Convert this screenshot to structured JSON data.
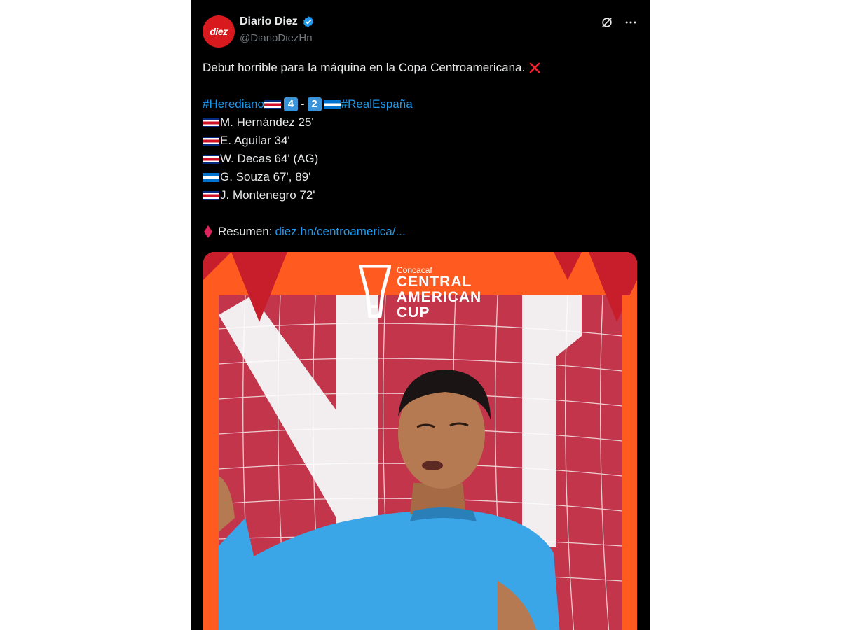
{
  "account": {
    "avatar_text": "diez",
    "display_name": "Diario Diez",
    "handle": "@DiarioDiezHn"
  },
  "tweet": {
    "headline": "Debut horrible para la máquina en la Copa Centroamericana.",
    "home_team": "#Herediano",
    "home_score": "4",
    "score_separator": "-",
    "away_score": "2",
    "away_team": "#RealEspaña",
    "scorers": [
      {
        "flag": "costa-rica",
        "text": "M. Hernández 25'"
      },
      {
        "flag": "costa-rica",
        "text": "E. Aguilar 34'"
      },
      {
        "flag": "costa-rica",
        "text": "W. Decas 64' (AG)"
      },
      {
        "flag": "honduras",
        "text": "G. Souza 67', 89'"
      },
      {
        "flag": "costa-rica",
        "text": "J. Montenegro 72'"
      }
    ],
    "summary_label": "Resumen:",
    "summary_link": "diez.hn/centroamerica/..."
  },
  "media": {
    "logo_small": "Concacaf",
    "logo_line1": "CENTRAL",
    "logo_line2": "AMERICAN",
    "logo_line3": "CUP"
  },
  "colors": {
    "background": "#000000",
    "text": "#e7e9ea",
    "muted": "#71767b",
    "link": "#1d9bf0",
    "brand_red": "#d8191e",
    "frame_orange": "#ff5a1f",
    "goalkeeper_shirt": "#3aa6e8"
  },
  "icons": [
    "verified-badge-icon",
    "grok-icon",
    "more-icon",
    "cross-mark-icon",
    "red-diamond-icon",
    "costa-rica-flag-icon",
    "honduras-flag-icon",
    "central-american-cup-trophy-icon"
  ]
}
